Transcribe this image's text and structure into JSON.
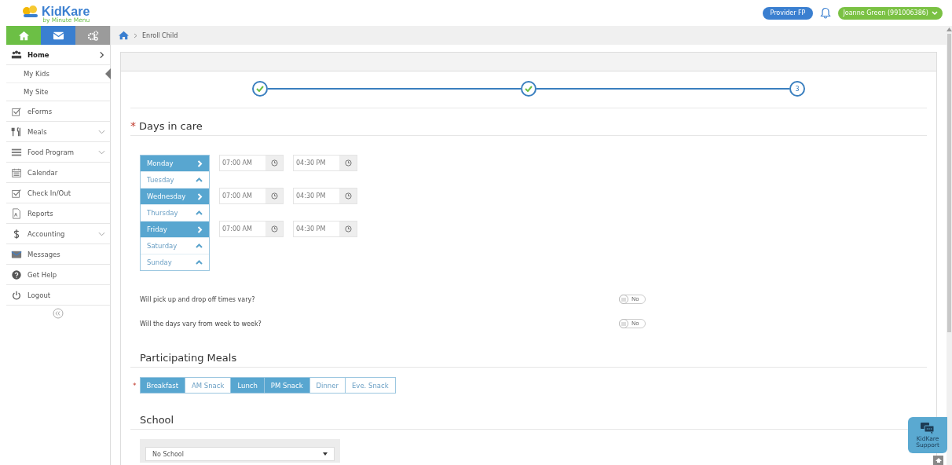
{
  "header": {
    "logo": "KidKare",
    "logo_tagline": "by Minute Menu",
    "provider_button": "Provider FP",
    "user_button": "Joanne Green (991006386)"
  },
  "sidebar": {
    "tabs": [
      {
        "kind": "home",
        "color": "#6cbf45"
      },
      {
        "kind": "mail",
        "color": "#3a7fd0"
      },
      {
        "kind": "gears",
        "color": "#9b9b9b"
      }
    ],
    "items": [
      {
        "label": "Home",
        "expandable": true,
        "expanded": true,
        "selected": true,
        "children": [
          {
            "label": "My Kids",
            "selected": true
          },
          {
            "label": "My Site",
            "selected": false
          }
        ]
      },
      {
        "label": "eForms",
        "expandable": false,
        "selected": false
      },
      {
        "label": "Meals",
        "expandable": true,
        "expanded": false,
        "selected": false
      },
      {
        "label": "Food Program",
        "expandable": true,
        "expanded": false,
        "selected": false
      },
      {
        "label": "Calendar",
        "expandable": false,
        "selected": false
      },
      {
        "label": "Check In/Out",
        "expandable": false,
        "selected": false
      },
      {
        "label": "Reports",
        "expandable": false,
        "selected": false
      },
      {
        "label": "Accounting",
        "expandable": true,
        "expanded": false,
        "selected": false
      },
      {
        "label": "Messages",
        "expandable": false,
        "selected": false
      },
      {
        "label": "Get Help",
        "expandable": false,
        "selected": false
      },
      {
        "label": "Logout",
        "expandable": false,
        "selected": false
      }
    ]
  },
  "breadcrumb": [
    "Enroll Child"
  ],
  "stepper": [
    {
      "completed": true
    },
    {
      "completed": true
    },
    {
      "completed": false,
      "label": "3"
    }
  ],
  "days_in_care": {
    "title": "Days in care",
    "required_mark": "*",
    "days": [
      {
        "name": "Monday",
        "selected": true,
        "start": "07:00 AM",
        "end": "04:30 PM"
      },
      {
        "name": "Tuesday",
        "selected": false
      },
      {
        "name": "Wednesday",
        "selected": true,
        "start": "07:00 AM",
        "end": "04:30 PM"
      },
      {
        "name": "Thursday",
        "selected": false
      },
      {
        "name": "Friday",
        "selected": true,
        "start": "07:00 AM",
        "end": "04:30 PM"
      },
      {
        "name": "Saturday",
        "selected": false
      },
      {
        "name": "Sunday",
        "selected": false
      }
    ]
  },
  "questions": [
    {
      "text": "Will pick up and drop off times vary?",
      "on": false,
      "toggle_label": "No"
    },
    {
      "text": "Will the days vary from week to week?",
      "on": false,
      "toggle_label": "No"
    }
  ],
  "participating_meals": {
    "title": "Participating Meals",
    "required_mark": "*",
    "meals": [
      {
        "label": "Breakfast",
        "selected": true
      },
      {
        "label": "AM Snack",
        "selected": false
      },
      {
        "label": "Lunch",
        "selected": true
      },
      {
        "label": "PM Snack",
        "selected": true
      },
      {
        "label": "Dinner",
        "selected": false
      },
      {
        "label": "Eve. Snack",
        "selected": false
      }
    ]
  },
  "school": {
    "title": "School",
    "value": "No School"
  },
  "support_button": "KidKare Support"
}
